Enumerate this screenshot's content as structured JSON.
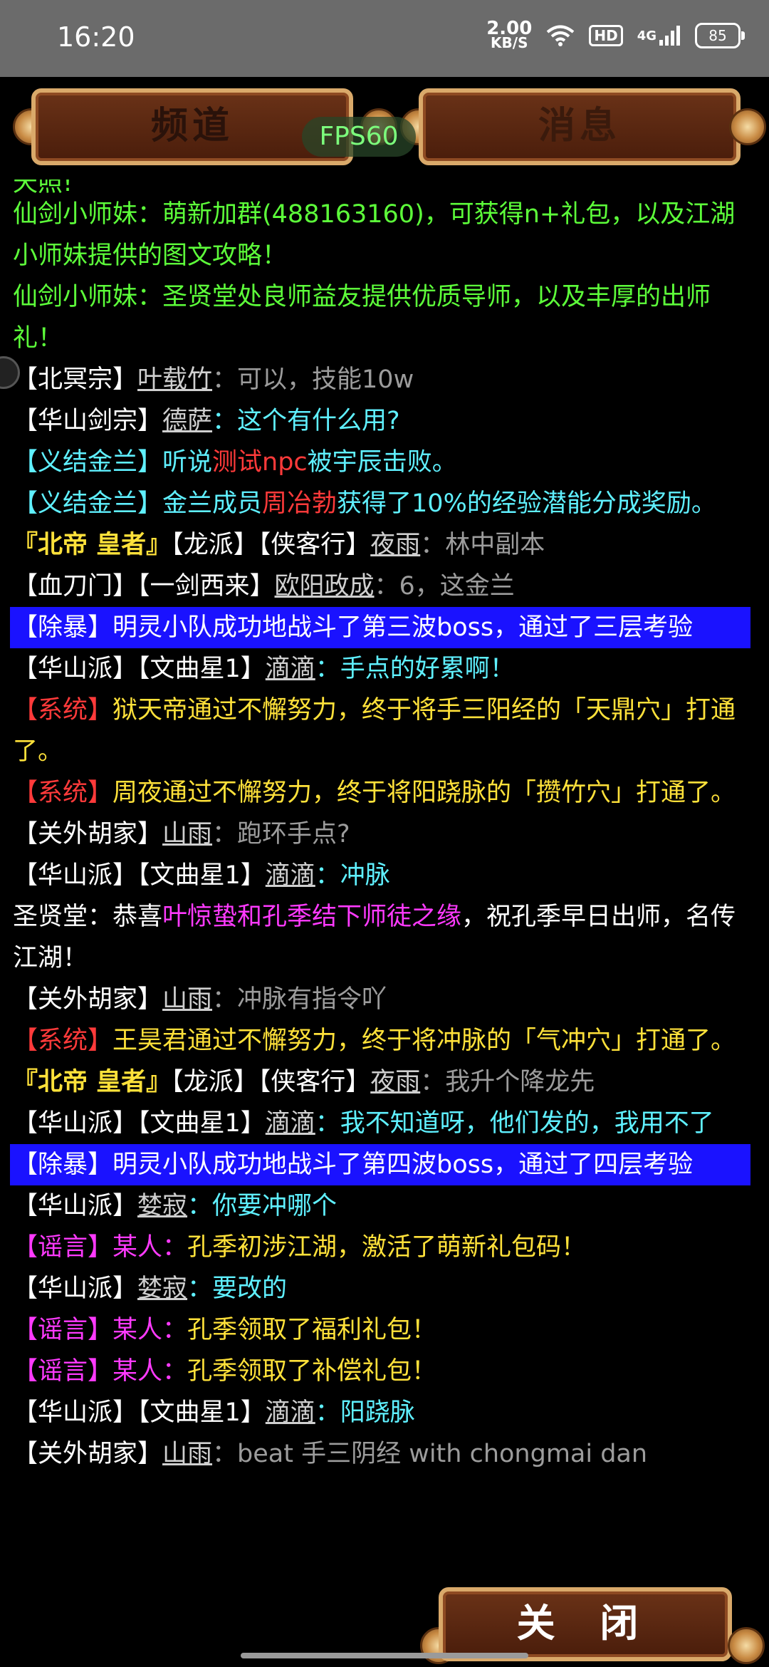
{
  "statusbar": {
    "time": "16:20",
    "speed_value": "2.00",
    "speed_unit": "KB/S",
    "hd": "HD",
    "network": "4G",
    "battery": "85"
  },
  "tabs": {
    "channel": "频道",
    "message": "消息"
  },
  "fps": "FPS60",
  "chat": {
    "l1": "天照!",
    "l2": "仙剑小师妹：萌新加群(488163160)，可获得n+礼包，以及江湖小师妹提供的图文攻略！",
    "l3": "仙剑小师妹：圣贤堂处良师益友提供优质导师，以及丰厚的出师礼！",
    "l4_prefix": "【北冥宗】",
    "l4_name": "叶载竹",
    "l4_msg": "：可以，技能10w",
    "l5_prefix": "【华山剑宗】",
    "l5_name": "德萨",
    "l5_msg": "：这个有什么用?",
    "l6_a": "【义结金兰】听说",
    "l6_b": "测试npc",
    "l6_c": "被宇辰",
    "l6_d": "击败。",
    "l7_a": "【义结金兰】金兰成员",
    "l7_b": "周冶勃",
    "l7_c": "获得了10%的经验潜能分成奖励。",
    "l8_a": "『北帝 皇者』",
    "l8_b": "【龙派】【侠客行】",
    "l8_name": "夜雨",
    "l8_msg": "：林中副本",
    "l9_a": "【血刀门】【一剑西来】",
    "l9_name": "欧阳政成",
    "l9_msg": "：6，这金兰",
    "l10": "【除暴】明灵小队成功地战斗了第三波boss，通过了三层考验",
    "l11_a": "【华山派】【文曲星1】",
    "l11_name": "滴滴",
    "l11_msg": "：手点的好累啊！",
    "l12_a": "【系统】",
    "l12_b": "狱天帝通过不懈努力，终于将手三阳经的「天鼎穴」打通了。",
    "l13_a": "【系统】",
    "l13_b": "周夜通过不懈努力，终于将阳跷脉的「攒竹穴」打通了。",
    "l14_a": "【关外胡家】",
    "l14_name": "山雨",
    "l14_msg": "：跑环手点?",
    "l15_a": "【华山派】【文曲星1】",
    "l15_name": "滴滴",
    "l15_msg": "：冲脉",
    "l16_a": "圣贤堂：恭喜",
    "l16_b": "叶惊蛰和孔季结下师徒之缘",
    "l16_c": "，祝孔季早日出师，名传江湖！",
    "l17_a": "【关外胡家】",
    "l17_name": "山雨",
    "l17_msg": "：冲脉有指令吖",
    "l18_a": "【系统】",
    "l18_b": "王昊君通过不懈努力，终于将冲脉的「气冲穴」打通了。",
    "l19_a": "『北帝 皇者』",
    "l19_b": "【龙派】【侠客行】",
    "l19_name": "夜雨",
    "l19_msg": "：我升个降龙先",
    "l20_a": "【华山派】【文曲星1】",
    "l20_name": "滴滴",
    "l20_msg": "：我不知道呀，他们发的，我用不了",
    "l21": "【除暴】明灵小队成功地战斗了第四波boss，通过了四层考验",
    "l22_a": "【华山派】",
    "l22_name": "婪寂",
    "l22_msg": "：你要冲哪个",
    "l23_a": "【谣言】某人：",
    "l23_b": "孔季初涉江湖，激活了萌新礼包码！",
    "l24_a": "【华山派】",
    "l24_name": "婪寂",
    "l24_msg": "：要改的",
    "l25_a": "【谣言】某人：",
    "l25_b": "孔季领取了福利礼包！",
    "l26_a": "【谣言】某人：",
    "l26_b": "孔季领取了补偿礼包！",
    "l27_a": "【华山派】【文曲星1】",
    "l27_name": "滴滴",
    "l27_msg": "：阳跷脉",
    "l28_a": "【关外胡家】",
    "l28_name": "山雨",
    "l28_msg": "：beat 手三阴经 with chongmai dan"
  },
  "close_button": "关 闭"
}
